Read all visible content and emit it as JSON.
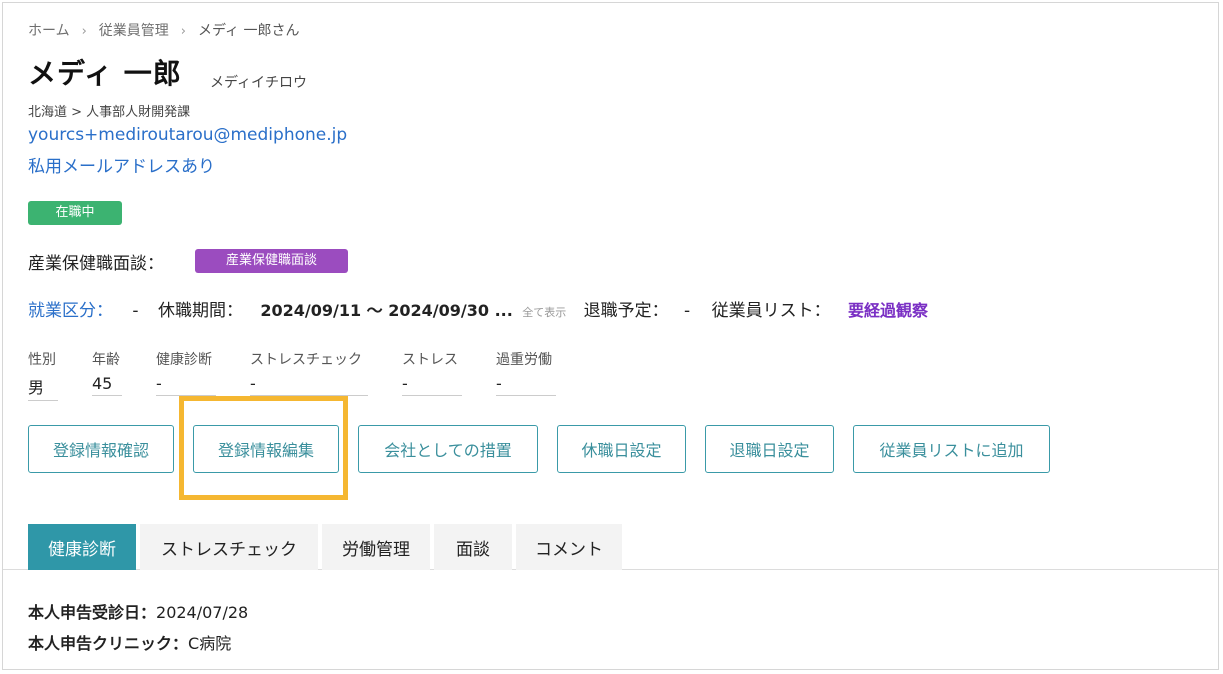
{
  "breadcrumb": {
    "items": [
      "ホーム",
      "従業員管理",
      "メディ 一郎さん"
    ],
    "separator": "›"
  },
  "employee": {
    "name": "メディ 一郎",
    "kana": "メディイチロウ",
    "department": "北海道 > 人事部人財開発課",
    "email": "yourcs+mediroutarou@mediphone.jp",
    "private_email_note": "私用メールアドレスあり",
    "status_badge": "在職中"
  },
  "sangyo": {
    "label": "産業保健職面談：",
    "badge": "産業保健職面談"
  },
  "info_row": {
    "work_category_label": "就業区分：",
    "work_category_value": "-",
    "leave_label": "休職期間：",
    "leave_value": "2024/09/11 ～ 2024/09/30 ...",
    "show_all": "全て表示",
    "retire_label": "退職予定：",
    "retire_value": "-",
    "list_label": "従業員リスト：",
    "list_value": "要経過観察"
  },
  "stats": [
    {
      "label": "性別",
      "value": "男"
    },
    {
      "label": "年齢",
      "value": "45"
    },
    {
      "label": "健康診断",
      "value": "-"
    },
    {
      "label": "ストレスチェック",
      "value": "-"
    },
    {
      "label": "ストレス",
      "value": "-"
    },
    {
      "label": "過重労働",
      "value": "-"
    }
  ],
  "buttons": [
    "登録情報確認",
    "登録情報編集",
    "会社としての措置",
    "休職日設定",
    "退職日設定",
    "従業員リストに追加"
  ],
  "tabs": [
    "健康診断",
    "ストレスチェック",
    "労働管理",
    "面談",
    "コメント"
  ],
  "details": [
    {
      "label": "本人申告受診日：",
      "value": "2024/07/28"
    },
    {
      "label": "本人申告クリニック：",
      "value": "C病院"
    }
  ],
  "colors": {
    "accent": "#2f97a8",
    "highlight": "#f5b731",
    "status_green": "#3cb371",
    "purple": "#9b4cbf",
    "link": "#2a6fc9"
  }
}
